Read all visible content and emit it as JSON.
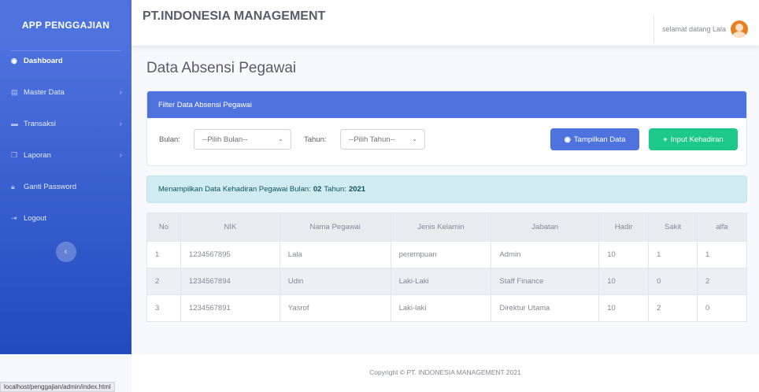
{
  "sidebar": {
    "brand": "APP PENGGAJIAN",
    "items": [
      {
        "label": "Dashboard",
        "icon": "dashboard-icon"
      },
      {
        "label": "Master Data",
        "icon": "database-icon"
      },
      {
        "label": "Transaksi",
        "icon": "money-icon"
      },
      {
        "label": "Laporan",
        "icon": "copy-icon"
      },
      {
        "label": "Ganti Password",
        "icon": "lock-icon"
      },
      {
        "label": "Logout",
        "icon": "logout-icon"
      }
    ]
  },
  "topbar": {
    "company": "PT.INDONESIA MANAGEMENT",
    "welcome": "selamat datang Lala"
  },
  "page": {
    "title": "Data Absensi Pegawai"
  },
  "filter": {
    "header": "Filter Data Absensi Pegawai",
    "bulan_label": "Bulan:",
    "bulan_value": "--Pilih Bulan--",
    "tahun_label": "Tahun:",
    "tahun_value": "--Pilih Tahun--",
    "show_button": "Tampilkan Data",
    "input_button": "Input Kehadiran"
  },
  "alert": {
    "text": "Menampilkan Data Kehadiran Pegawai Bulan:",
    "month": "02",
    "year_label": "Tahun:",
    "year": "2021"
  },
  "table": {
    "headers": [
      "No",
      "NIK",
      "Nama Pegawai",
      "Jenis Kelamin",
      "Jabatan",
      "Hadir",
      "Sakit",
      "alfa"
    ],
    "rows": [
      [
        "1",
        "1234567895",
        "Lala",
        "perempuan",
        "Admin",
        "10",
        "1",
        "1"
      ],
      [
        "2",
        "1234567894",
        "Udin",
        "Laki-Laki",
        "Staff Finance",
        "10",
        "0",
        "2"
      ],
      [
        "3",
        "1234567891",
        "Yasrof",
        "Laki-laki",
        "Direktur Utama",
        "10",
        "2",
        "0"
      ]
    ]
  },
  "footer": {
    "copyright": "Copyright © PT. INDONESIA MANAGEMENT 2021",
    "status_url": "localhost/penggajian/admin/index.html"
  }
}
